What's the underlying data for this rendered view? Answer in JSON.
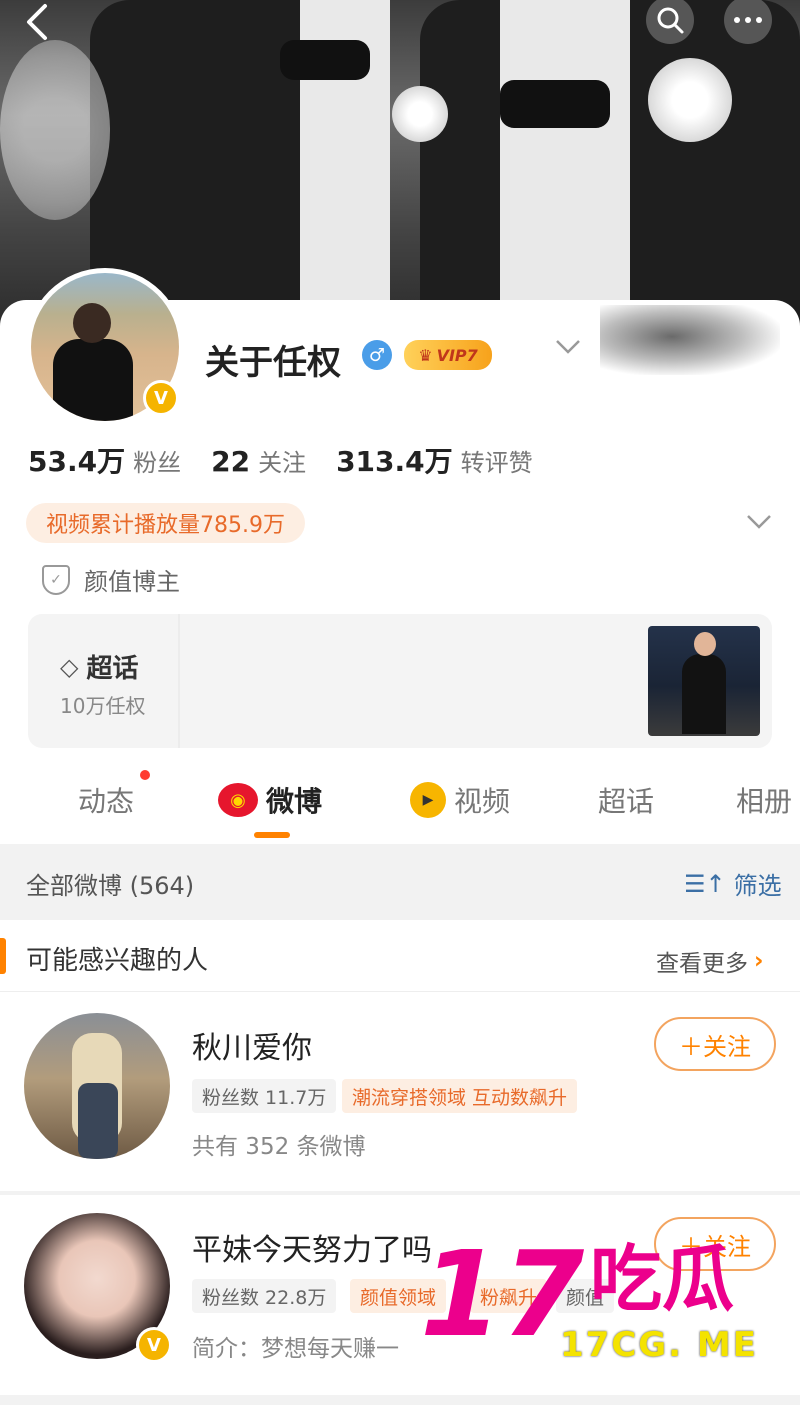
{
  "profile": {
    "name": "关于任权",
    "gender_icon": "male-icon",
    "vip_label": "VIP7",
    "verified_label": "V",
    "stats": [
      {
        "num": "53.4万",
        "label": "粉丝"
      },
      {
        "num": "22",
        "label": "关注"
      },
      {
        "num": "313.4万",
        "label": "转评赞"
      }
    ],
    "video_plays": "视频累计播放量785.9万",
    "tagline": "颜值博主"
  },
  "super_topic": {
    "title": "超话",
    "sub": "10万任权"
  },
  "tabs": [
    {
      "label": "动态"
    },
    {
      "label": "微博"
    },
    {
      "label": "视频"
    },
    {
      "label": "超话"
    },
    {
      "label": "相册"
    }
  ],
  "filter": {
    "label": "全部微博 (564)",
    "button": "筛选"
  },
  "section": {
    "title": "可能感兴趣的人",
    "more": "查看更多"
  },
  "recommendations": [
    {
      "name": "秋川爱你",
      "fans": "粉丝数 11.7万",
      "tag": "潮流穿搭领域 互动数飙升",
      "desc": "共有 352 条微博",
      "follow": "＋关注"
    },
    {
      "name": "平妹今天努力了吗",
      "fans": "粉丝数 22.8万",
      "tag": "颜值领域",
      "tag2": "粉飙升",
      "tag3": "颜值",
      "desc": "简介：梦想每天赚一",
      "follow": "＋关注"
    }
  ],
  "watermark": {
    "big": "17",
    "cn": "吃瓜",
    "url": "17CG. ME"
  },
  "colors": {
    "accent": "#ff8200",
    "link": "#3b6fa5",
    "vip_gold": "#f7a21b"
  }
}
